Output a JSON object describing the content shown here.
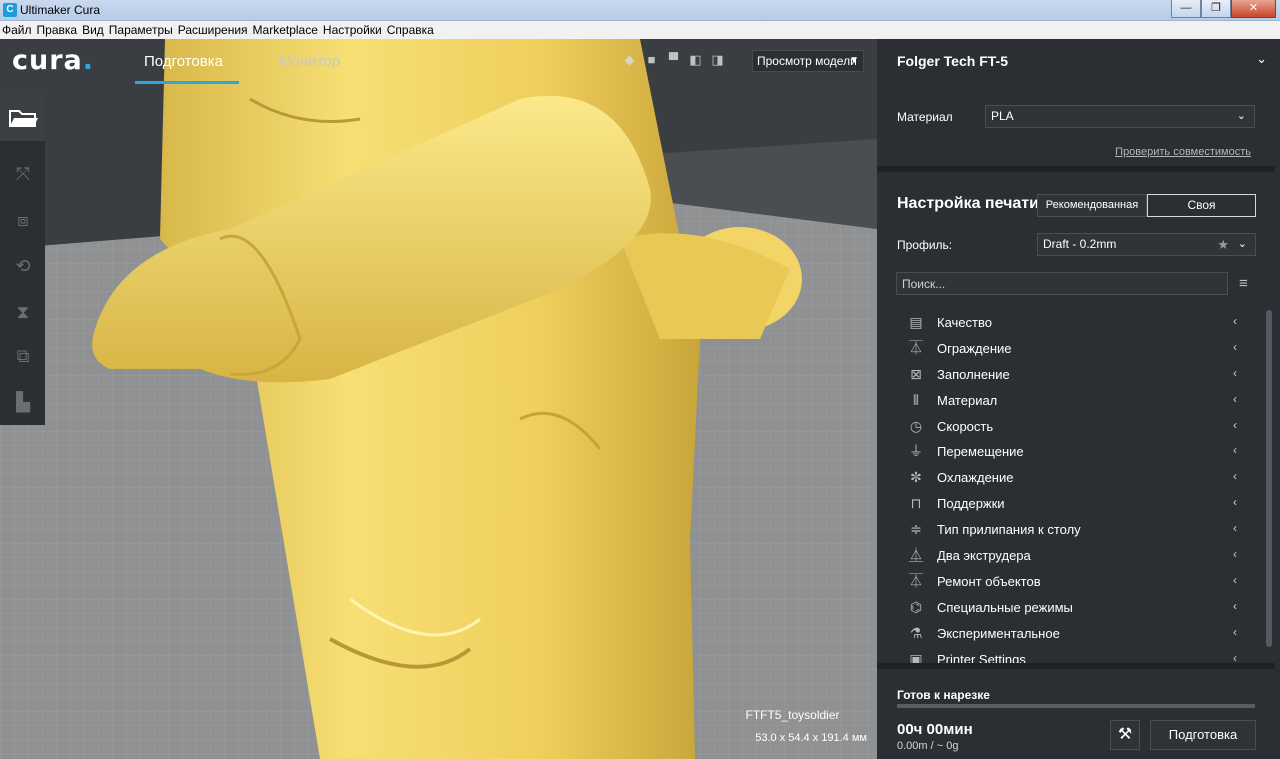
{
  "window": {
    "title": "Ultimaker Cura",
    "app_icon": "C",
    "minimize": "—",
    "maximize": "❐",
    "close": "✕"
  },
  "menu": [
    "Файл",
    "Правка",
    "Вид",
    "Параметры",
    "Расширения",
    "Marketplace",
    "Настройки",
    "Справка"
  ],
  "header": {
    "logo": "cura",
    "tabs": [
      {
        "label": "Подготовка",
        "active": true
      },
      {
        "label": "Монитор",
        "active": false
      }
    ],
    "view_mode": "Просмотр модели"
  },
  "model": {
    "name": "FTFT5_toysoldier",
    "dimensions": "53.0 x 54.4 x 191.4 мм"
  },
  "sidebar": {
    "printer": "Folger Tech FT-5",
    "material_label": "Материал",
    "material_value": "PLA",
    "compat_link": "Проверить совместимость",
    "print_setup_title": "Настройка печати",
    "mode_recommended": "Рекомендованная",
    "mode_custom": "Своя",
    "profile_label": "Профиль:",
    "profile_value": "Draft - 0.2mm",
    "search_placeholder": "Поиск...",
    "categories": [
      {
        "label": "Качество",
        "icon": "quality-icon"
      },
      {
        "label": "Ограждение",
        "icon": "shell-icon"
      },
      {
        "label": "Заполнение",
        "icon": "infill-icon"
      },
      {
        "label": "Материал",
        "icon": "material-icon"
      },
      {
        "label": "Скорость",
        "icon": "speed-icon"
      },
      {
        "label": "Перемещение",
        "icon": "travel-icon"
      },
      {
        "label": "Охлаждение",
        "icon": "cooling-icon"
      },
      {
        "label": "Поддержки",
        "icon": "support-icon"
      },
      {
        "label": "Тип прилипания к столу",
        "icon": "adhesion-icon"
      },
      {
        "label": "Два экструдера",
        "icon": "dual-extruder-icon"
      },
      {
        "label": "Ремонт объектов",
        "icon": "mesh-fix-icon"
      },
      {
        "label": "Специальные режимы",
        "icon": "special-modes-icon"
      },
      {
        "label": "Экспериментальное",
        "icon": "experimental-icon"
      },
      {
        "label": "Printer Settings",
        "icon": "printer-settings-icon"
      }
    ],
    "status": "Готов к нарезке",
    "time": "00ч 00мин",
    "estimate": "0.00m / ~ 0g",
    "prepare_button": "Подготовка"
  },
  "colors": {
    "accent": "#30a5e0",
    "panel": "#2b2e33",
    "model": "#f5dc72"
  }
}
